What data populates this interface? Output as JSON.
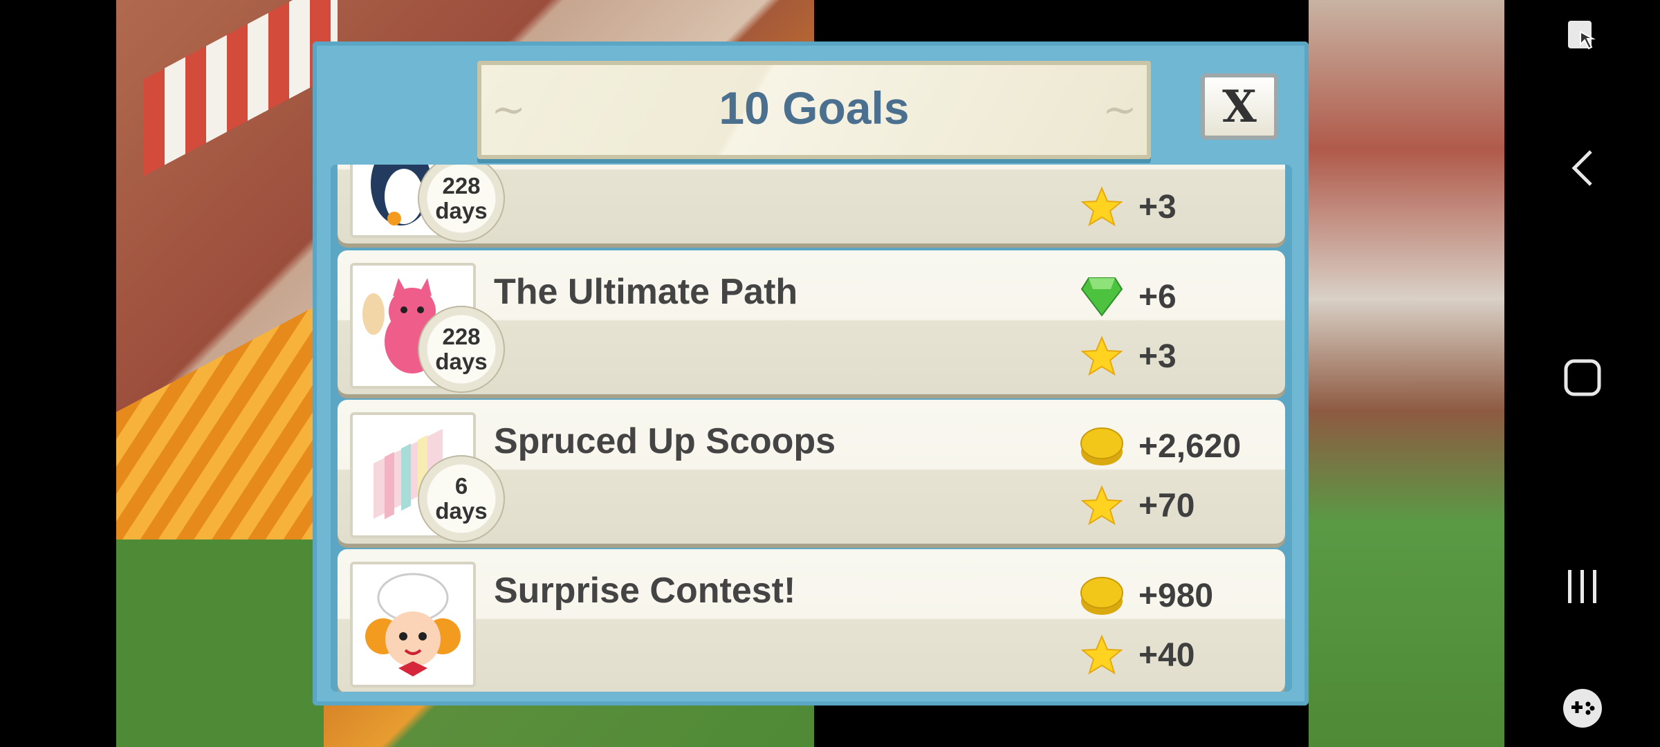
{
  "dialog": {
    "title": "10 Goals",
    "close_label": "X"
  },
  "goals": [
    {
      "name": "",
      "days_value": "228",
      "days_unit": "days",
      "rewards": [
        {
          "icon": "star-icon",
          "value": "+3"
        }
      ]
    },
    {
      "name": "The Ultimate Path",
      "days_value": "228",
      "days_unit": "days",
      "rewards": [
        {
          "icon": "gem-icon",
          "value": "+6"
        },
        {
          "icon": "star-icon",
          "value": "+3"
        }
      ]
    },
    {
      "name": "Spruced Up Scoops",
      "days_value": "6",
      "days_unit": "days",
      "rewards": [
        {
          "icon": "coin-icon",
          "value": "+2,620"
        },
        {
          "icon": "star-icon",
          "value": "+70"
        }
      ]
    },
    {
      "name": "Surprise Contest!",
      "rewards": [
        {
          "icon": "coin-icon",
          "value": "+980"
        },
        {
          "icon": "star-icon",
          "value": "+40"
        }
      ]
    }
  ],
  "colors": {
    "dialog_bg": "#6fb7d3",
    "title_text": "#4a6f8f",
    "star": "#ffd31f",
    "gem": "#4cc23f",
    "coin": "#f2c719"
  }
}
